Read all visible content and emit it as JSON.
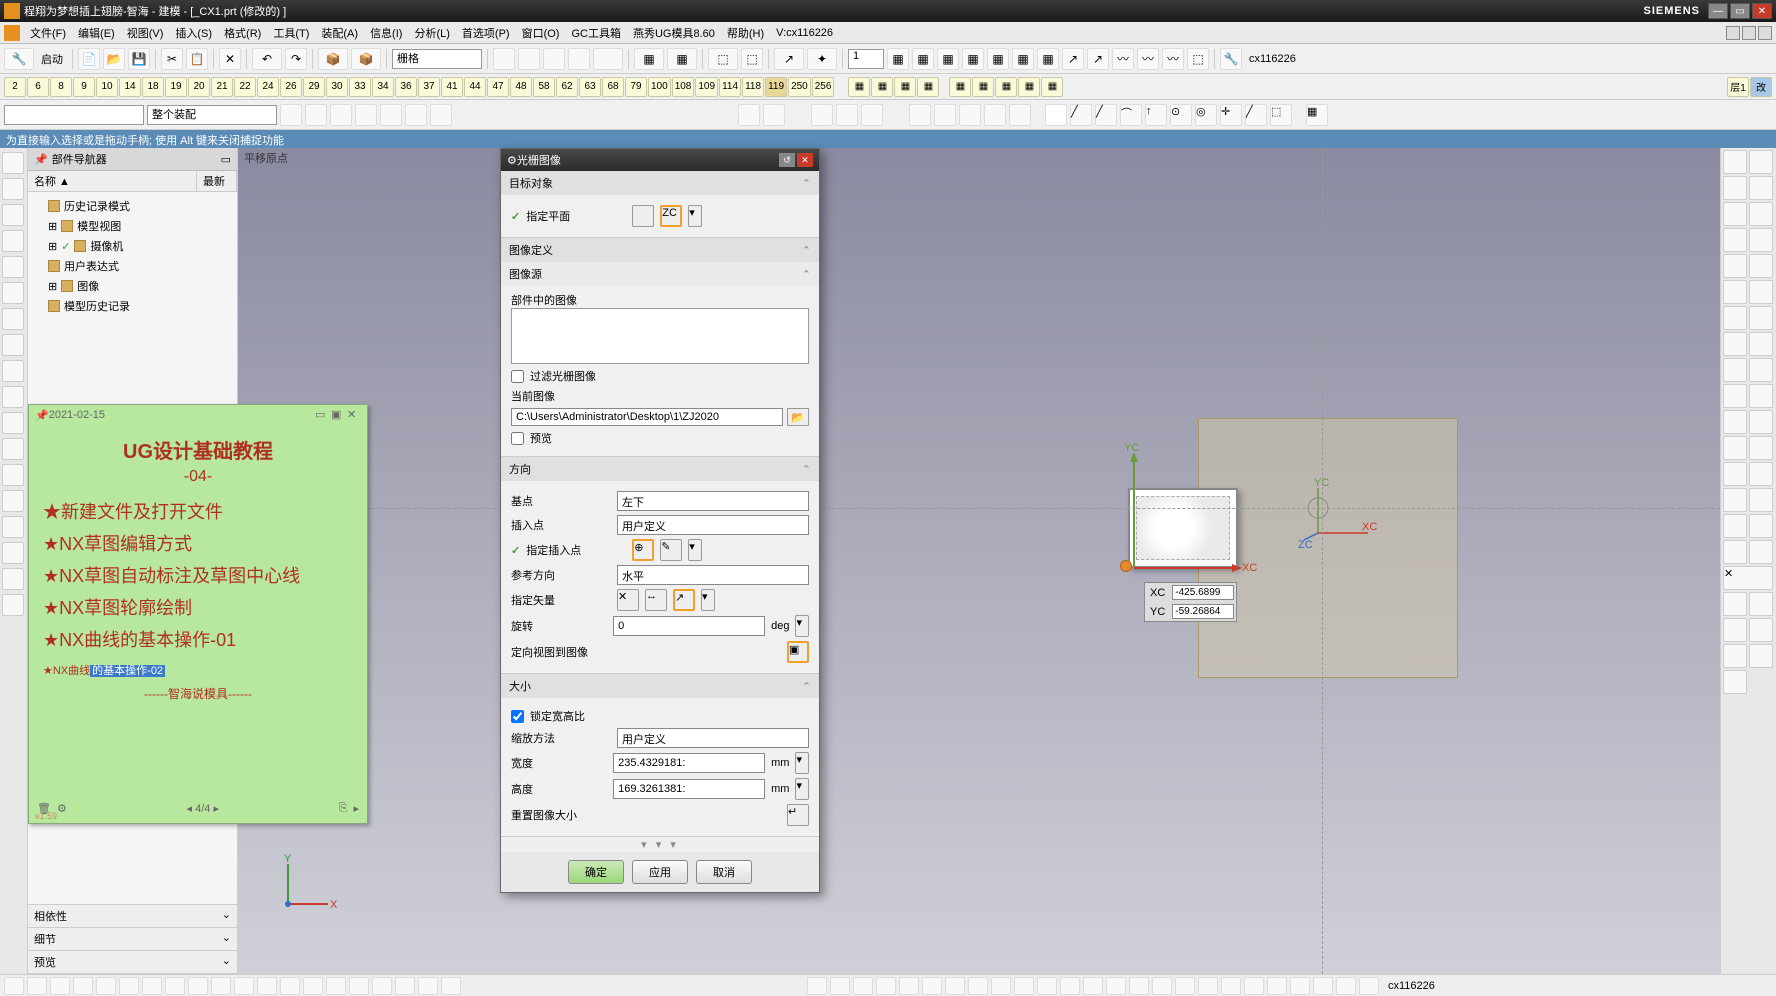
{
  "title": "程翔为梦想插上翅膀-智海 - 建模 - [_CX1.prt  (修改的) ]",
  "brand": "SIEMENS",
  "menus": [
    "文件(F)",
    "编辑(E)",
    "视图(V)",
    "插入(S)",
    "格式(R)",
    "工具(T)",
    "装配(A)",
    "信息(I)",
    "分析(L)",
    "首选项(P)",
    "窗口(O)",
    "GC工具箱",
    "燕秀UG模具8.60",
    "帮助(H)",
    "V:cx116226"
  ],
  "toolbar1": {
    "start": "启动",
    "combo": "栅格",
    "numinput": "1",
    "lblright": "cx116226"
  },
  "numbar": [
    "2",
    "6",
    "8",
    "9",
    "10",
    "14",
    "18",
    "19",
    "20",
    "21",
    "22",
    "24",
    "26",
    "29",
    "30",
    "33",
    "34",
    "36",
    "37",
    "41",
    "44",
    "47",
    "48",
    "58",
    "62",
    "63",
    "68",
    "79",
    "100",
    "108",
    "109",
    "114",
    "118",
    "119",
    "250",
    "256"
  ],
  "numbar_right": [
    "层1",
    "改"
  ],
  "selbar": {
    "combo1": "",
    "combo2": "整个装配"
  },
  "hint": "为直接输入选择或是拖动手柄; 使用 Alt 键来关闭捕捉功能",
  "nav": {
    "title": "部件导航器",
    "col1": "名称",
    "col2": "最新",
    "nodes": [
      "历史记录模式",
      "模型视图",
      "摄像机",
      "用户表达式",
      "图像",
      "模型历史记录"
    ]
  },
  "bottom_sections": [
    "相依性",
    "细节",
    "预览"
  ],
  "sticky": {
    "date": "2021-02-15",
    "title": "UG设计基础教程",
    "sub": "-04-",
    "lines": [
      "★新建文件及打开文件",
      "★NX草图编辑方式",
      "★NX草图自动标注及草图中心线",
      "★NX草图轮廓绘制",
      "★NX曲线的基本操作-01"
    ],
    "line_hl_pre": "★NX曲线",
    "line_hl": "的基本操作-02",
    "sig": "------智海说模具------",
    "page": "4/4",
    "ver": "v1.59"
  },
  "viewport": {
    "origin": "平移原点",
    "xc": "XC",
    "yc": "YC",
    "coord_xc": "XC",
    "coord_yc": "YC",
    "val_xc": "-425.6899",
    "val_yc": "-59.26864"
  },
  "dialog": {
    "title": "光栅图像",
    "sec_target": "目标对象",
    "row_plane": "指定平面",
    "sec_imgdef": "图像定义",
    "sub_imgsrc": "图像源",
    "lbl_partimg": "部件中的图像",
    "chk_filter": "过滤光栅图像",
    "lbl_curimg": "当前图像",
    "path": "C:\\Users\\Administrator\\Desktop\\1\\ZJ2020",
    "chk_preview": "预览",
    "sec_dir": "方向",
    "lbl_base": "基点",
    "val_base": "左下",
    "lbl_insert": "插入点",
    "val_insert": "用户定义",
    "lbl_specins": "指定插入点",
    "lbl_refdir": "参考方向",
    "val_refdir": "水平",
    "lbl_specvec": "指定矢量",
    "lbl_rotate": "旋转",
    "val_rotate": "0",
    "unit_rotate": "deg",
    "lbl_orient": "定向视图到图像",
    "sec_size": "大小",
    "chk_lock": "锁定宽高比",
    "lbl_scale": "缩放方法",
    "val_scale": "用户定义",
    "lbl_w": "宽度",
    "val_w": "235.4329181:",
    "unit_w": "mm",
    "lbl_h": "高度",
    "val_h": "169.3261381:",
    "unit_h": "mm",
    "lbl_reset": "重置图像大小",
    "btn_ok": "确定",
    "btn_apply": "应用",
    "btn_cancel": "取消"
  },
  "status": {
    "text": "cx116226"
  }
}
